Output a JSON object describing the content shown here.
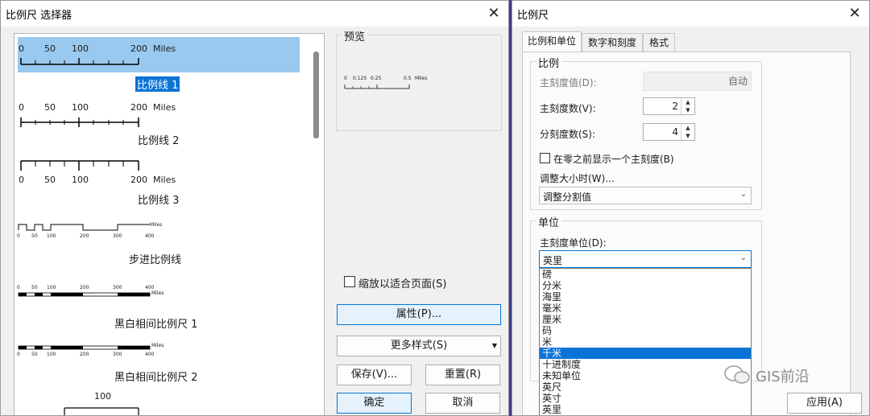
{
  "left_window": {
    "title": "比例尺 选择器",
    "items": [
      {
        "label": "比例线 1",
        "ticks": [
          "0",
          "50",
          "100",
          "200",
          "Miles"
        ]
      },
      {
        "label": "比例线 2",
        "ticks": [
          "0",
          "50",
          "100",
          "200",
          "Miles"
        ]
      },
      {
        "label": "比例线 3",
        "ticks": [
          "0",
          "50",
          "100",
          "200",
          "Miles"
        ]
      },
      {
        "label": "步进比例线",
        "ticks": [
          "0",
          "50",
          "100",
          "200",
          "300",
          "400",
          "Miles"
        ]
      },
      {
        "label": "黑白相间比例尺 1",
        "ticks": [
          "0",
          "50",
          "100",
          "200",
          "300",
          "400",
          "Miles"
        ]
      },
      {
        "label": "黑白相间比例尺 2",
        "ticks": [
          "0",
          "50",
          "100",
          "200",
          "300",
          "400",
          "Miles"
        ]
      },
      {
        "label": "",
        "ticks": [
          "100"
        ]
      }
    ],
    "preview_label": "预览",
    "preview_ticks": [
      "0",
      "0.125",
      "0.25",
      "0.5",
      "Miles"
    ],
    "fit_checkbox_label": "缩放以适合页面(S)",
    "properties_button": "属性(P)...",
    "more_styles_button": "更多样式(S)",
    "save_button": "保存(V)...",
    "reset_button": "重置(R)",
    "ok_button": "确定",
    "cancel_button": "取消"
  },
  "right_window": {
    "title": "比例尺",
    "tabs": [
      "比例和单位",
      "数字和刻度",
      "格式"
    ],
    "scale_group": {
      "title": "比例",
      "division_value_label": "主刻度值(D):",
      "division_value": "自动",
      "divisions_label": "主刻度数(V):",
      "divisions": "2",
      "subdivisions_label": "分刻度数(S):",
      "subdivisions": "4",
      "show_one_checkbox": "在零之前显示一个主刻度(B)",
      "resize_label": "调整大小时(W)...",
      "resize_value": "调整分割值"
    },
    "units_group": {
      "title": "单位",
      "division_units_label": "主刻度单位(D):",
      "division_units_value": "英里",
      "options": [
        "磅",
        "分米",
        "海里",
        "毫米",
        "厘米",
        "码",
        "米",
        "千米",
        "十进制度",
        "未知单位",
        "英尺",
        "英寸",
        "英里"
      ],
      "selected_option": "千米"
    },
    "apply_button": "应用(A)",
    "watermark": "GIS前沿",
    "colors": {
      "accent": "#0a74d6",
      "selection": "#99c9ef"
    }
  }
}
